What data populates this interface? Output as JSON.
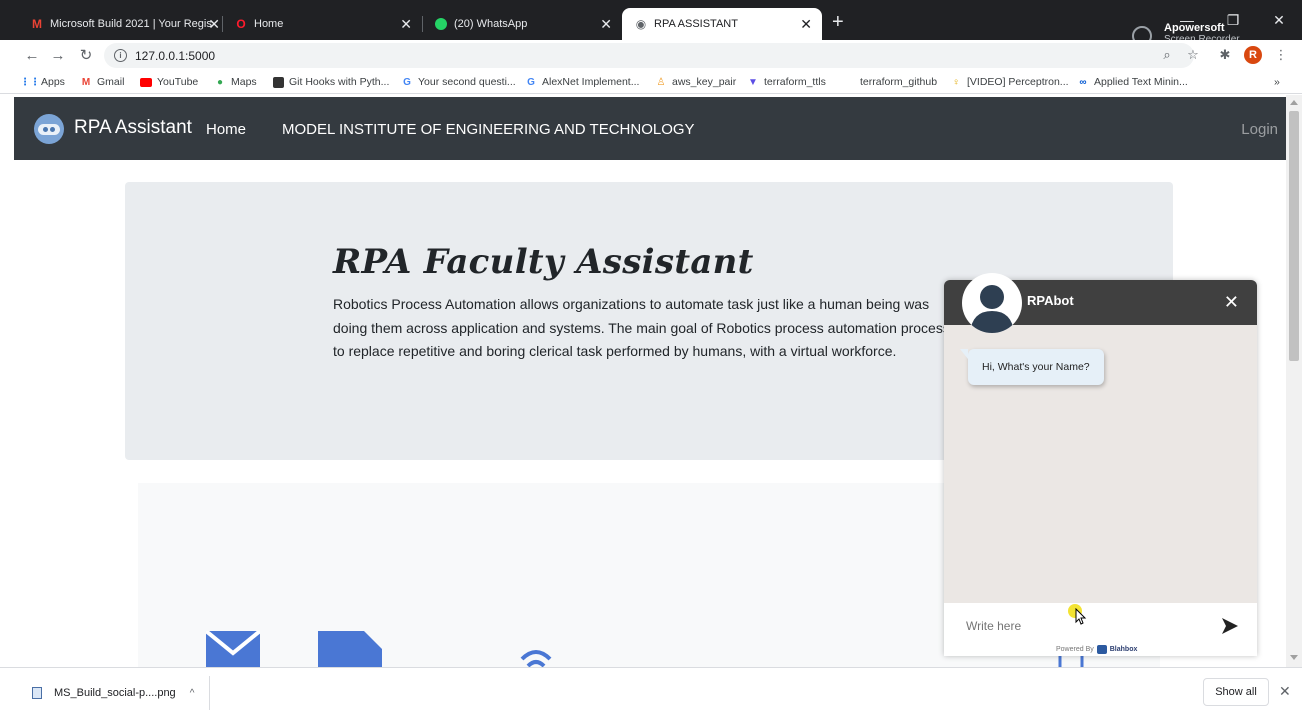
{
  "browser": {
    "tabs": [
      {
        "title": "Microsoft Build 2021 | Your Regis",
        "icon": "gmail-icon"
      },
      {
        "title": "Home",
        "icon": "opera-icon"
      },
      {
        "title": "(20) WhatsApp",
        "icon": "whatsapp-icon"
      },
      {
        "title": "RPA ASSISTANT",
        "icon": "globe-icon"
      }
    ],
    "url": "127.0.0.1:5000",
    "bookmarks": [
      {
        "label": "Apps",
        "icon": "apps-grid-icon"
      },
      {
        "label": "Gmail",
        "icon": "gmail-icon"
      },
      {
        "label": "YouTube",
        "icon": "youtube-icon"
      },
      {
        "label": "Maps",
        "icon": "maps-pin-icon"
      },
      {
        "label": "Git Hooks with Pyth...",
        "icon": "bookmark-page-icon"
      },
      {
        "label": "Your second questi...",
        "icon": "google-icon"
      },
      {
        "label": "AlexNet Implement...",
        "icon": "google-icon"
      },
      {
        "label": "aws_key_pair",
        "icon": "aws-icon"
      },
      {
        "label": "terraform_ttls",
        "icon": "terraform-icon"
      },
      {
        "label": "terraform_github",
        "icon": ""
      },
      {
        "label": "[VIDEO] Perceptron...",
        "icon": "lightbulb-icon"
      },
      {
        "label": "Applied Text Minin...",
        "icon": "coursera-icon"
      }
    ],
    "watermark": {
      "title": "Apowersoft",
      "subtitle": "Screen Recorder"
    },
    "profile_initial": "R"
  },
  "site": {
    "brand": "RPA Assistant",
    "nav": [
      "Home",
      "MODEL INSTITUTE OF ENGINEERING AND TECHNOLOGY"
    ],
    "login": "Login",
    "hero": {
      "title": "RPA Faculty Assistant",
      "text": "Robotics Process Automation allows organizations to automate task just like a human being was doing them across application and systems. The main goal of Robotics process automation process to replace repetitive and boring clerical task performed by humans, with a virtual workforce."
    }
  },
  "chat": {
    "bot_name": "RPAbot",
    "message": "Hi, What's your Name?",
    "input_placeholder": "Write here",
    "powered_by": "Powered By",
    "powered_brand": "Blahbox"
  },
  "downloads": {
    "file": "MS_Build_social-p....png",
    "show_all": "Show all"
  },
  "colors": {
    "navbar": "#343a40",
    "hero_bg": "#e9ecef",
    "chat_header": "#404040",
    "feature_icon": "#4a77d4"
  }
}
